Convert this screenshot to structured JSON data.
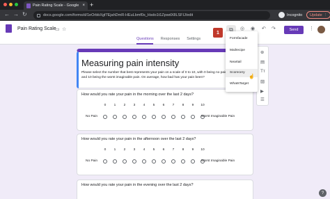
{
  "browser": {
    "tab_title": "Pain Rating Scale - Google Form",
    "tab_close": "×",
    "new_tab": "+",
    "url": "docs.google.com/forms/d/1eOrbbXgf7EjahDmR-HEuLbmf0s_Hsdo1t1ZpwdX8LSFIJ/edit",
    "incognito_label": "Incognito",
    "update_label": "Update",
    "dot_colors": [
      "#ff5f57",
      "#febc2e",
      "#28c840"
    ]
  },
  "header": {
    "form_title": "Pain Rating Scale",
    "badge_number": "1",
    "send_label": "Send",
    "tabs": [
      "Questions",
      "Responses",
      "Settings"
    ],
    "accent": "#673ab7"
  },
  "form": {
    "heading": "Measuring pain intensity",
    "description": "Please select the number that best represents your pain on a scale of 0 to 10, with 0 being no pain and 10 being the worst imaginable pain. On average, how bad has your pain been?"
  },
  "questions": [
    {
      "title": "How would you rate your pain in the morning over the last 2 days?",
      "low_label": "No Pain",
      "high_label": "Worst Imaginable Pain",
      "scale": [
        "0",
        "1",
        "2",
        "3",
        "4",
        "5",
        "6",
        "7",
        "8",
        "9",
        "10"
      ]
    },
    {
      "title": "How would you rate your pain in the afternoon over the last 2 days?",
      "low_label": "No Pain",
      "high_label": "Worst Imaginable Pain",
      "scale": [
        "0",
        "1",
        "2",
        "3",
        "4",
        "5",
        "6",
        "7",
        "8",
        "9",
        "10"
      ]
    },
    {
      "title": "How would you rate your pain in the evening over the last 2 days?",
      "low_label": "",
      "high_label": "",
      "scale": []
    }
  ],
  "addons_menu": {
    "items": [
      "Formfacade",
      "Mailrecipe",
      "Neartail",
      "Scorecery",
      "WhatsTarget"
    ],
    "hovered": "Scorecery"
  }
}
